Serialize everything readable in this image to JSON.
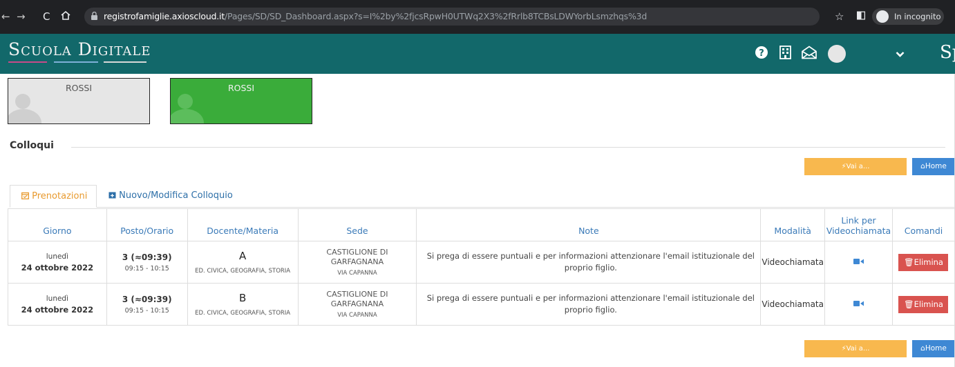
{
  "browser": {
    "url_host": "registrofamiglie.axioscloud.it",
    "url_path": "/Pages/SD/SD_Dashboard.aspx?s=I%2by%2fjcsRpwH0UTWq2X3%2fRrlb8TCBsLDWYorbLsmzhqs%3d",
    "incognito_label": "In incognito"
  },
  "app": {
    "brand": "Scuola Digitale",
    "brand_color": "#12686a",
    "header_partial": "Sp"
  },
  "students": [
    {
      "name": "ROSSI",
      "selected": false
    },
    {
      "name": "ROSSI",
      "selected": true
    }
  ],
  "section": {
    "title": "Colloqui"
  },
  "actions": {
    "vai_label": "Vai a...",
    "home_label": "Home"
  },
  "tabs": [
    {
      "label": "Prenotazioni",
      "active": true
    },
    {
      "label": "Nuovo/Modifica Colloquio",
      "active": false
    }
  ],
  "table": {
    "headers": {
      "giorno": "Giorno",
      "posto": "Posto/Orario",
      "docente": "Docente/Materia",
      "sede": "Sede",
      "note": "Note",
      "modalita": "Modalità",
      "link_1": "Link per",
      "link_2": "Videochiamata",
      "comandi": "Comandi"
    },
    "rows": [
      {
        "day": "lunedì",
        "date": "24 ottobre 2022",
        "slot": "3 (≈09:39)",
        "time": "09:15 - 10:15",
        "teacher": "A",
        "subject": "ED. CIVICA, GEOGRAFIA, STORIA",
        "sede_1": "CASTIGLIONE DI",
        "sede_2": "GARFAGNANA",
        "sede_street": "VIA CAPANNA",
        "note": "Si prega di essere puntuali e per informazioni attenzionare l'email istituzionale del proprio figlio.",
        "modalita": "Videochiamata",
        "delete_label": "Elimina"
      },
      {
        "day": "lunedì",
        "date": "24 ottobre 2022",
        "slot": "3 (≈09:39)",
        "time": "09:15 - 10:15",
        "teacher": "B",
        "subject": "ED. CIVICA, GEOGRAFIA, STORIA",
        "sede_1": "CASTIGLIONE DI",
        "sede_2": "GARFAGNANA",
        "sede_street": "VIA CAPANNA",
        "note": "Si prega di essere puntuali e per informazioni attenzionare l'email istituzionale del proprio figlio.",
        "modalita": "Videochiamata",
        "delete_label": "Elimina"
      }
    ]
  },
  "colors": {
    "vai": "#f8b84e",
    "home": "#3e88d4",
    "elimina": "#d9534f",
    "student_selected": "#3aac3a",
    "student_default": "#e6e6e6",
    "header_text": "#3a7ab8"
  }
}
